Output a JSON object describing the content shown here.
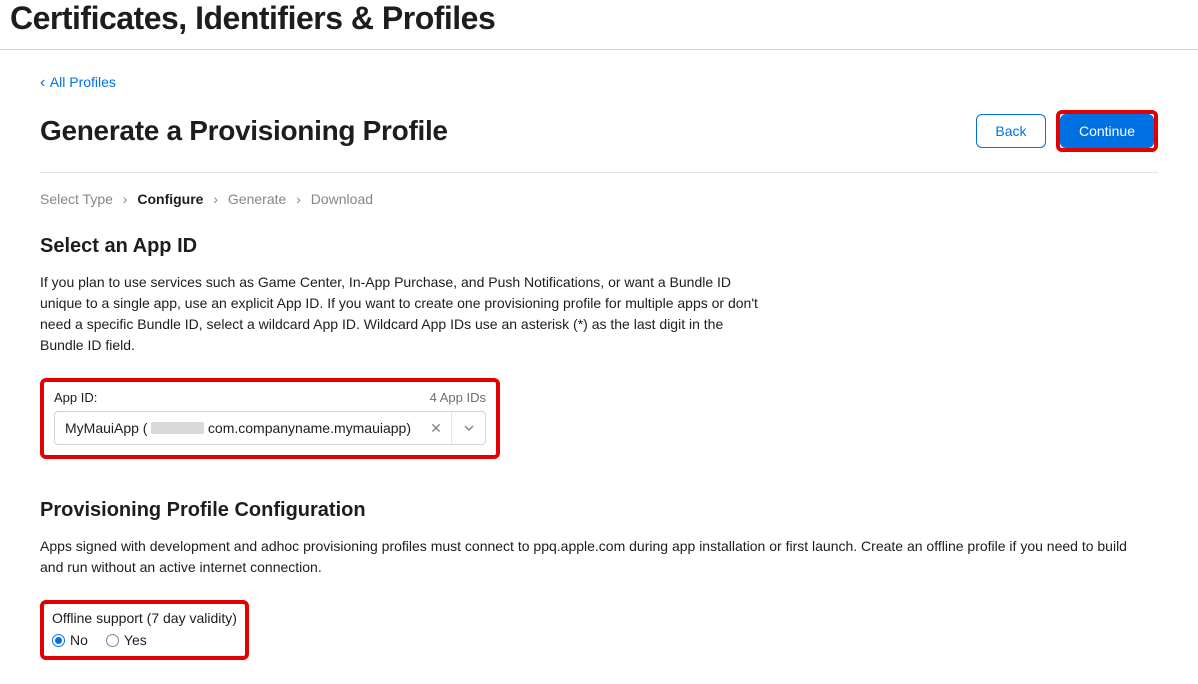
{
  "header": {
    "title": "Certificates, Identifiers & Profiles"
  },
  "nav": {
    "back_link": "All Profiles"
  },
  "page": {
    "title": "Generate a Provisioning Profile",
    "back_button": "Back",
    "continue_button": "Continue"
  },
  "breadcrumb": {
    "steps": [
      "Select Type",
      "Configure",
      "Generate",
      "Download"
    ],
    "active_index": 1
  },
  "appid_section": {
    "heading": "Select an App ID",
    "description": "If you plan to use services such as Game Center, In-App Purchase, and Push Notifications, or want a Bundle ID unique to a single app, use an explicit App ID. If you want to create one provisioning profile for multiple apps or don't need a specific Bundle ID, select a wildcard App ID. Wildcard App IDs use an asterisk (*) as the last digit in the Bundle ID field.",
    "field_label": "App ID:",
    "count_label": "4 App IDs",
    "value_prefix": "MyMauiApp (",
    "value_suffix": "com.companyname.mymauiapp)"
  },
  "config_section": {
    "heading": "Provisioning Profile Configuration",
    "description": "Apps signed with development and adhoc provisioning profiles must connect to ppq.apple.com during app installation or first launch. Create an offline profile if you need to build and run without an active internet connection.",
    "offline_label": "Offline support (7 day validity)",
    "option_no": "No",
    "option_yes": "Yes",
    "selected": "No"
  }
}
